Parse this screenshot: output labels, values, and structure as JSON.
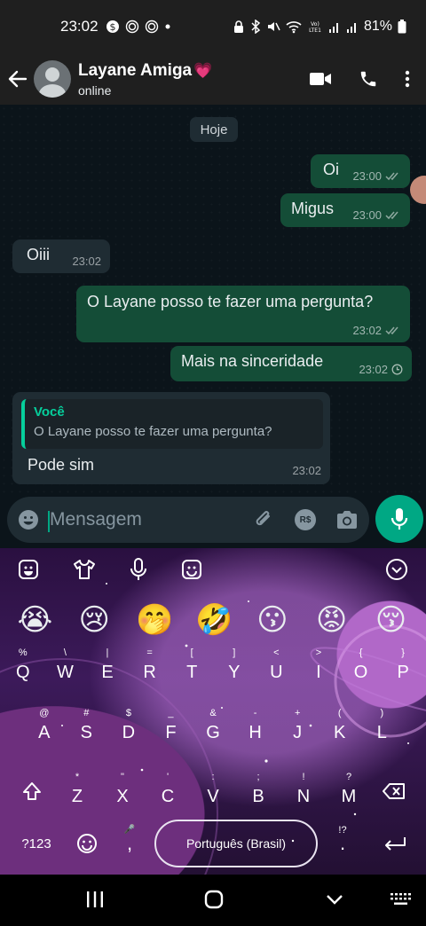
{
  "status_bar": {
    "time": "23:02",
    "battery": "81%"
  },
  "header": {
    "contact_name": "Layane Amiga",
    "contact_emoji": "💗",
    "status": "online"
  },
  "chat": {
    "date_chip": "Hoje",
    "messages": [
      {
        "text": "Oi",
        "time": "23:00",
        "direction": "out",
        "status": "read"
      },
      {
        "text": "Migus",
        "time": "23:00",
        "direction": "out",
        "status": "read"
      },
      {
        "text": "Oiii",
        "time": "23:02",
        "direction": "in"
      },
      {
        "text": "O Layane posso te fazer uma pergunta?",
        "time": "23:02",
        "direction": "out",
        "status": "read"
      },
      {
        "text": "Mais na sinceridade",
        "time": "23:02",
        "direction": "out",
        "status": "pending"
      },
      {
        "text": "Pode sim",
        "time": "23:02",
        "direction": "in",
        "quote": {
          "author": "Você",
          "text": "O Layane posso te fazer uma pergunta?"
        }
      }
    ]
  },
  "composer": {
    "placeholder": "Mensagem",
    "currency_label": "R$"
  },
  "keyboard": {
    "emojis": [
      "😭",
      "😢",
      "🤭",
      "🤣",
      "😗",
      "😡",
      "😚"
    ],
    "row1": [
      {
        "k": "Q",
        "a": "%"
      },
      {
        "k": "W",
        "a": "\\"
      },
      {
        "k": "E",
        "a": "|"
      },
      {
        "k": "R",
        "a": "="
      },
      {
        "k": "T",
        "a": "["
      },
      {
        "k": "Y",
        "a": "]"
      },
      {
        "k": "U",
        "a": "<"
      },
      {
        "k": "I",
        "a": ">"
      },
      {
        "k": "O",
        "a": "{"
      },
      {
        "k": "P",
        "a": "}"
      }
    ],
    "row2": [
      {
        "k": "A",
        "a": "@"
      },
      {
        "k": "S",
        "a": "#"
      },
      {
        "k": "D",
        "a": "$"
      },
      {
        "k": "F",
        "a": "_"
      },
      {
        "k": "G",
        "a": "&"
      },
      {
        "k": "H",
        "a": "-"
      },
      {
        "k": "J",
        "a": "+"
      },
      {
        "k": "K",
        "a": "("
      },
      {
        "k": "L",
        "a": ")"
      }
    ],
    "row3": [
      {
        "k": "Z",
        "a": "*"
      },
      {
        "k": "X",
        "a": "\""
      },
      {
        "k": "C",
        "a": "'"
      },
      {
        "k": "V",
        "a": ":"
      },
      {
        "k": "B",
        "a": ";"
      },
      {
        "k": "N",
        "a": "!"
      },
      {
        "k": "M",
        "a": "?"
      }
    ],
    "symbols_key": "?123",
    "comma": ",",
    "space_label": "Português (Brasil)",
    "punct_alt": "!?",
    "period": "."
  },
  "colors": {
    "outgoing_bubble": "#144d37",
    "incoming_bubble": "#1f2c33",
    "accent": "#00a884",
    "quote_author": "#06cf9c"
  }
}
